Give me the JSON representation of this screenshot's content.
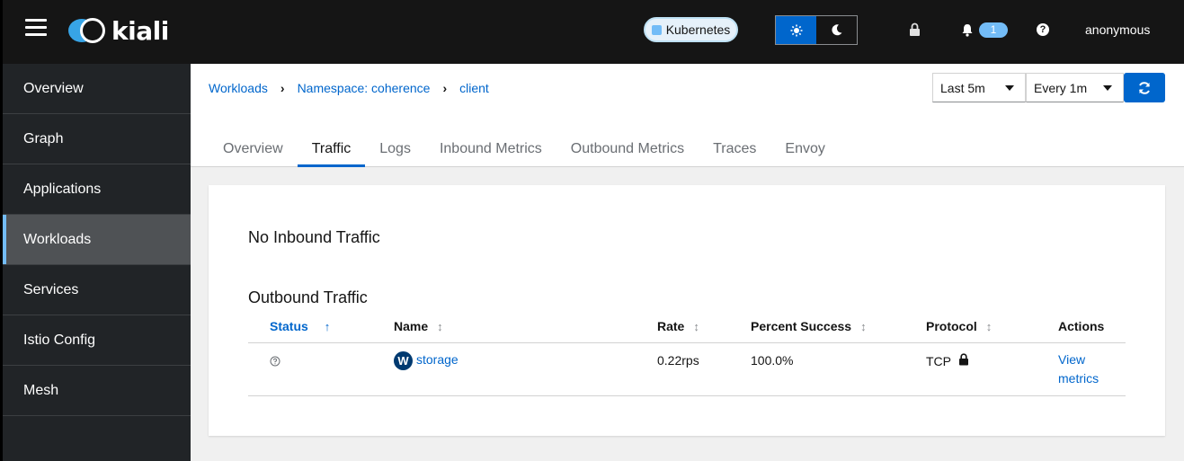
{
  "masthead": {
    "logo_text": "kiali",
    "cluster_label": "Kubernetes",
    "notification_count": "1",
    "help_glyph": "?",
    "username": "anonymous"
  },
  "sidebar": {
    "items": [
      {
        "label": "Overview"
      },
      {
        "label": "Graph"
      },
      {
        "label": "Applications"
      },
      {
        "label": "Workloads"
      },
      {
        "label": "Services"
      },
      {
        "label": "Istio Config"
      },
      {
        "label": "Mesh"
      }
    ],
    "active": "Workloads"
  },
  "breadcrumb": {
    "items": [
      "Workloads",
      "Namespace: coherence",
      "client"
    ]
  },
  "toolbar": {
    "time_range": "Last 5m",
    "refresh_interval": "Every 1m"
  },
  "tabs": [
    {
      "label": "Overview"
    },
    {
      "label": "Traffic"
    },
    {
      "label": "Logs"
    },
    {
      "label": "Inbound Metrics"
    },
    {
      "label": "Outbound Metrics"
    },
    {
      "label": "Traces"
    },
    {
      "label": "Envoy"
    }
  ],
  "active_tab": "Traffic",
  "traffic": {
    "inbound_title": "No Inbound Traffic",
    "outbound_title": "Outbound Traffic",
    "columns": {
      "status": "Status",
      "name": "Name",
      "rate": "Rate",
      "percent_success": "Percent Success",
      "protocol": "Protocol",
      "actions": "Actions"
    },
    "rows": [
      {
        "workload_badge": "W",
        "name": "storage",
        "rate": "0.22rps",
        "percent_success": "100.0%",
        "protocol": "TCP",
        "action": "View metrics"
      }
    ]
  },
  "colors": {
    "masthead_bg": "#151515",
    "sidebar_bg": "#212427",
    "accent": "#0066cc",
    "active_indicator": "#73bcf7"
  }
}
